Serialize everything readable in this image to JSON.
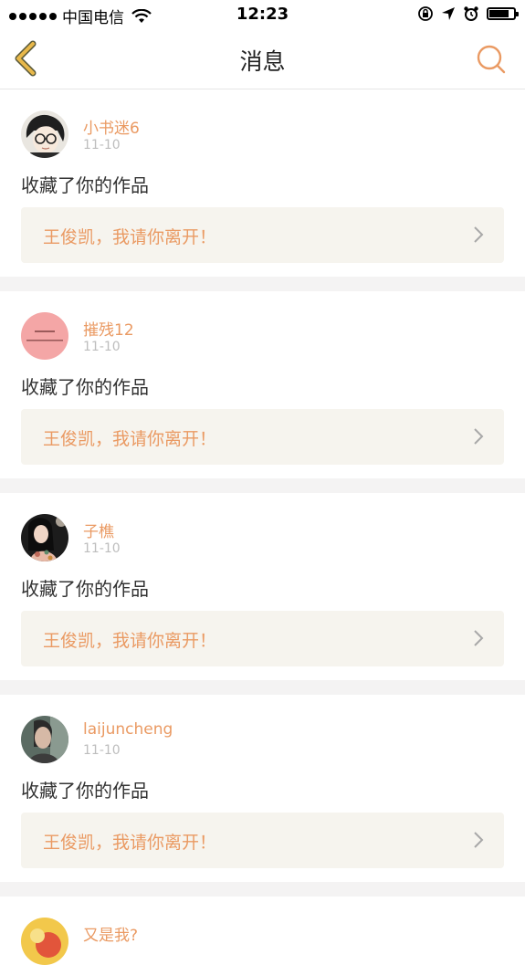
{
  "statusbar": {
    "carrier": "中国电信",
    "time": "12:23",
    "battery_level": 0.8
  },
  "navbar": {
    "title": "消息",
    "back_icon": "chevron-left-icon",
    "search_icon": "search-icon"
  },
  "colors": {
    "accent": "#ea9a63",
    "back_icon": "#e8b84a",
    "card_bg": "#f6f4ee",
    "date": "#bdbdbd",
    "separator": "#f4f3f3"
  },
  "messages": [
    {
      "username": "小书迷6",
      "date": "11-10",
      "action": "收藏了你的作品",
      "work_title": "王俊凯，我请你离开！",
      "avatar": "avatar-anime-glasses"
    },
    {
      "username": "摧残12",
      "date": "11-10",
      "action": "收藏了你的作品",
      "work_title": "王俊凯，我请你离开！",
      "avatar": "avatar-pink-text"
    },
    {
      "username": "子樵",
      "date": "11-10",
      "action": "收藏了你的作品",
      "work_title": "王俊凯，我请你离开！",
      "avatar": "avatar-photo-woman"
    },
    {
      "username": "laijuncheng",
      "date": "11-10",
      "action": "收藏了你的作品",
      "work_title": "王俊凯，我请你离开！",
      "avatar": "avatar-photo-man"
    },
    {
      "username": "又是我?",
      "avatar": "avatar-colorful"
    }
  ]
}
